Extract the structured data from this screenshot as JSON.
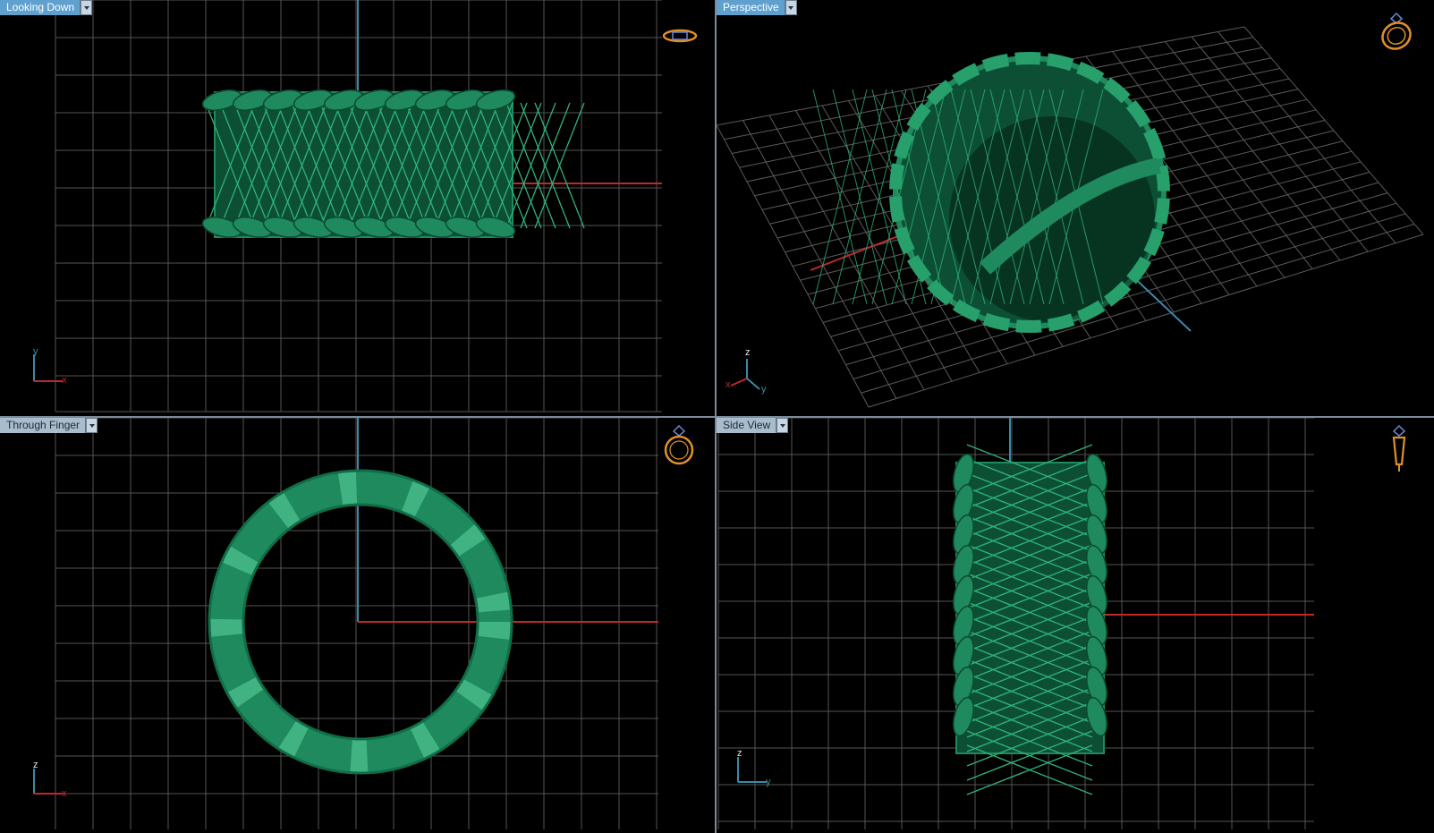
{
  "viewports": {
    "top_left": {
      "label": "Looking Down",
      "axes": [
        "y",
        "x"
      ],
      "icon": "ring-top-view-icon"
    },
    "top_right": {
      "label": "Perspective",
      "axes": [
        "z",
        "x",
        "y"
      ],
      "icon": "ring-perspective-icon"
    },
    "bottom_left": {
      "label": "Through Finger",
      "axes": [
        "z",
        "x"
      ],
      "icon": "ring-front-view-icon"
    },
    "bottom_right": {
      "label": "Side View",
      "axes": [
        "z",
        "y"
      ],
      "icon": "ring-side-view-icon"
    }
  },
  "colors": {
    "background": "#000000",
    "grid": "#5a5a5a",
    "axis_red": "#c0282a",
    "axis_blue": "#3a8aa8",
    "model_green": "#1e8a5e",
    "model_light": "#5fd3a1",
    "active_label": "#5fa0cf",
    "icon_orange": "#e0902a"
  }
}
